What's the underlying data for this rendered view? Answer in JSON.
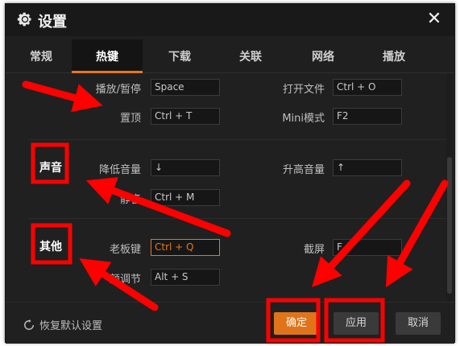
{
  "window": {
    "title": "设置"
  },
  "tabs": [
    {
      "label": "常规",
      "active": false
    },
    {
      "label": "热键",
      "active": true
    },
    {
      "label": "下载",
      "active": false
    },
    {
      "label": "关联",
      "active": false
    },
    {
      "label": "网络",
      "active": false
    },
    {
      "label": "播放",
      "active": false
    }
  ],
  "sections": {
    "sound": "声音",
    "other": "其他"
  },
  "hotkeys": {
    "play_pause": {
      "label": "播放/暂停",
      "value": "Space"
    },
    "open_file": {
      "label": "打开文件",
      "value": "Ctrl + O"
    },
    "pin_top": {
      "label": "置顶",
      "value": "Ctrl + T"
    },
    "mini_mode": {
      "label": "Mini模式",
      "value": "F2"
    },
    "vol_down": {
      "label": "降低音量",
      "value": "↓"
    },
    "vol_up": {
      "label": "升高音量",
      "value": "↑"
    },
    "mute": {
      "label": "静音",
      "value": "Ctrl + M"
    },
    "boss_key": {
      "label": "老板键",
      "value": "Ctrl + Q"
    },
    "screenshot": {
      "label": "截屏",
      "value": "F"
    },
    "color_adjust": {
      "label": "颜调节",
      "value": "Alt + S"
    }
  },
  "footer": {
    "restore_label": "恢复默认设置",
    "ok_label": "确定",
    "apply_label": "应用",
    "cancel_label": "取消"
  },
  "colors": {
    "accent": "#e8761b",
    "annotation": "#ff0000",
    "background": "#202020"
  }
}
